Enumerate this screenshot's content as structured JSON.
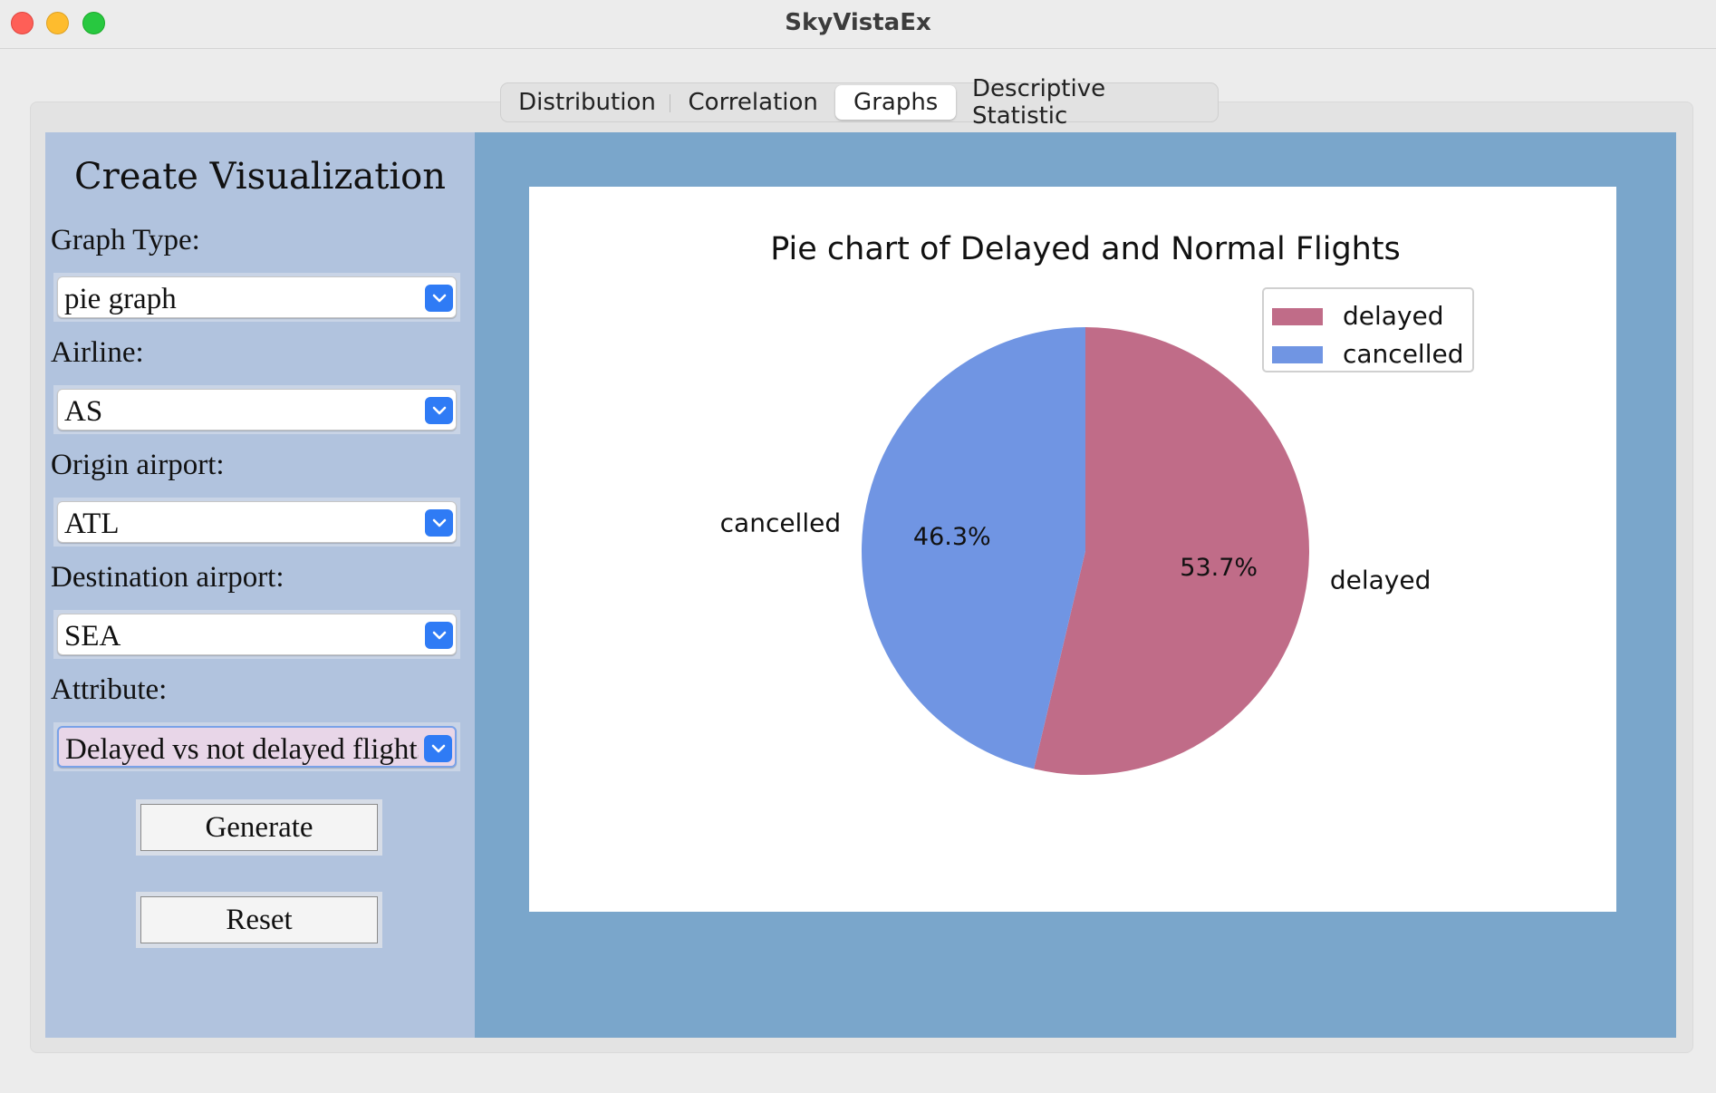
{
  "window": {
    "title": "SkyVistaEx"
  },
  "tabs": [
    {
      "label": "Distribution",
      "active": false
    },
    {
      "label": "Correlation",
      "active": false
    },
    {
      "label": "Graphs",
      "active": true
    },
    {
      "label": "Descriptive Statistic",
      "active": false
    }
  ],
  "sidebar": {
    "title": "Create Visualization",
    "fields": [
      {
        "label": "Graph Type:",
        "value": "pie graph"
      },
      {
        "label": "Airline:",
        "value": "AS"
      },
      {
        "label": "Origin airport:",
        "value": "ATL"
      },
      {
        "label": "Destination airport:",
        "value": "SEA"
      },
      {
        "label": "Attribute:",
        "value": "Delayed vs not delayed flights"
      }
    ],
    "generate_label": "Generate",
    "reset_label": "Reset"
  },
  "colors": {
    "delayed": "#c06c88",
    "cancelled": "#7095e3"
  },
  "chart_data": {
    "type": "pie",
    "title": "Pie chart of Delayed and Normal Flights",
    "categories": [
      "delayed",
      "cancelled"
    ],
    "values": [
      53.7,
      46.3
    ],
    "value_labels": [
      "53.7%",
      "46.3%"
    ],
    "start_angle_deg": 90,
    "direction": "clockwise",
    "legend": {
      "position": "top-right",
      "entries": [
        "delayed",
        "cancelled"
      ]
    }
  }
}
